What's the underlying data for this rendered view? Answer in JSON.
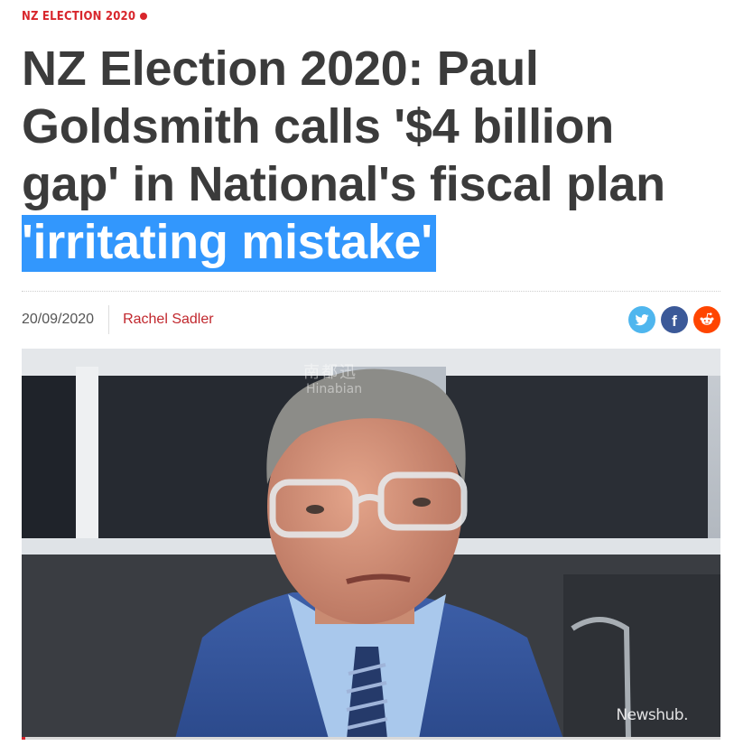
{
  "article": {
    "category": "NZ ELECTION 2020",
    "headline_main": "NZ Election 2020: Paul Goldsmith calls '$4 billion gap' in National's fiscal plan ",
    "headline_highlight": "'irritating mistake'",
    "date": "20/09/2020",
    "author": "Rachel Sadler"
  },
  "share": {
    "icons": [
      "twitter-icon",
      "facebook-icon",
      "reddit-icon"
    ],
    "facebook_glyph": "f"
  },
  "video": {
    "watermark_cn": "南都迅",
    "watermark_en": "Hinabian",
    "brand": "Newshub.",
    "progress": 0.005
  },
  "colors": {
    "accent": "#d8262c",
    "selection": "#3297fd",
    "twitter": "#4fb6ee",
    "facebook": "#3b5998",
    "reddit": "#ff4500"
  }
}
